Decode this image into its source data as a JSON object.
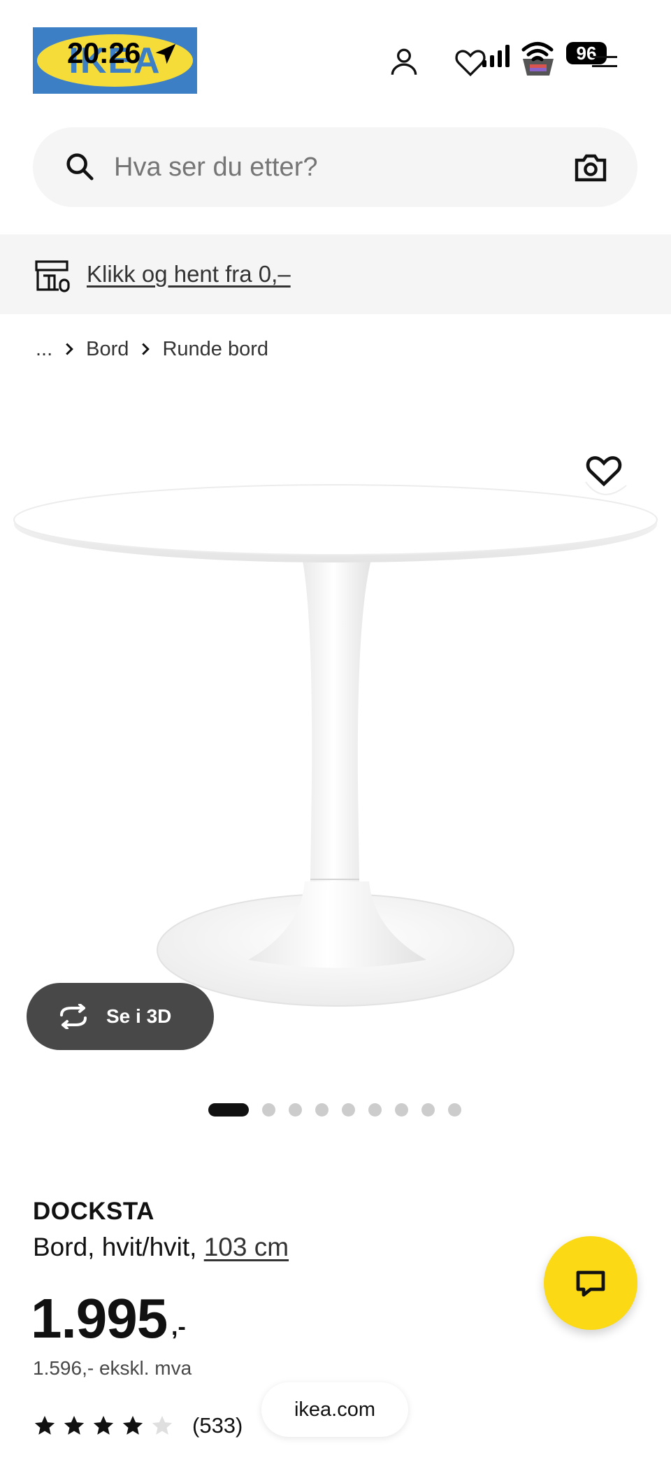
{
  "status_bar": {
    "time": "20:26",
    "battery": "96"
  },
  "header": {
    "logo_text": "IKEA",
    "icons": [
      "location-arrow-icon",
      "user-icon",
      "heart-icon",
      "signal-icon",
      "wifi-icon",
      "cart-icon",
      "menu-icon"
    ]
  },
  "search": {
    "placeholder": "Hva ser du etter?"
  },
  "banner": {
    "link_text": "Klikk og hent fra 0,–"
  },
  "breadcrumb": {
    "items": [
      "...",
      "Bord",
      "Runde bord"
    ]
  },
  "product": {
    "view_3d_label": "Se i 3D",
    "image_count": 9,
    "active_image_index": 0,
    "name": "DOCKSTA",
    "description": "Bord, hvit/hvit, ",
    "size_link": "103 cm",
    "price": "1.995",
    "price_suffix": ",-",
    "price_ex_vat": "1.596,- ekskl. mva",
    "rating_value": 4,
    "rating_max": 5,
    "rating_count": "(533)"
  },
  "browser": {
    "url": "ikea.com"
  },
  "colors": {
    "brand_blue": "#3d7fc4",
    "brand_yellow": "#f6dc38",
    "chat_yellow": "#fbd914",
    "panel_gray": "#f5f5f5",
    "dark_button": "#484848"
  }
}
